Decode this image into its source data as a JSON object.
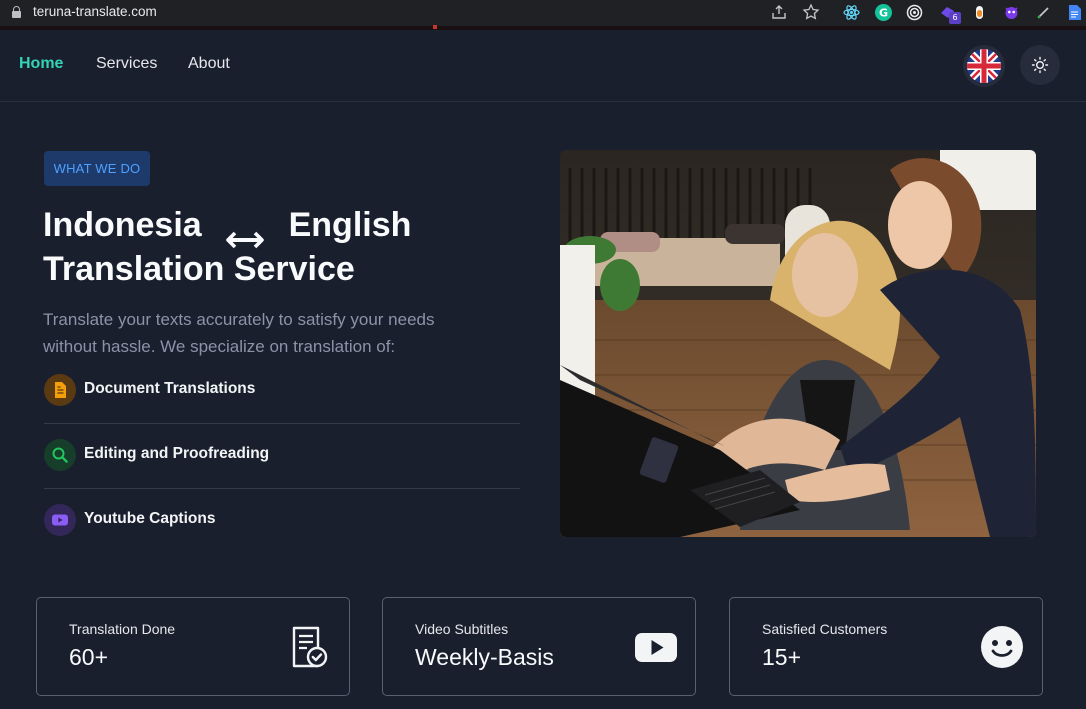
{
  "browser": {
    "url": "teruna-translate.com",
    "extension_badge": "6"
  },
  "nav": {
    "links": [
      {
        "label": "Home",
        "active": true
      },
      {
        "label": "Services",
        "active": false
      },
      {
        "label": "About",
        "active": false
      }
    ],
    "language_icon": "uk-flag-icon",
    "theme_icon": "sun-icon"
  },
  "hero": {
    "badge": "WHAT WE DO",
    "title_line1_left": "Indonesia",
    "title_line1_right": "English",
    "title_line2": "Translation Service",
    "description": "Translate your texts accurately to satisfy your needs without hassle. We specialize on translation of:",
    "services": [
      {
        "label": "Document Translations",
        "icon": "document-icon",
        "color": "#f59e0b"
      },
      {
        "label": "Editing and Proofreading",
        "icon": "search-icon",
        "color": "#22c55e"
      },
      {
        "label": "Youtube Captions",
        "icon": "youtube-icon",
        "color": "#8b5cf6"
      }
    ]
  },
  "stats": [
    {
      "title": "Translation Done",
      "value": "60+",
      "icon": "verified-document-icon"
    },
    {
      "title": "Video Subtitles",
      "value": "Weekly-Basis",
      "icon": "youtube-play-icon"
    },
    {
      "title": "Satisfied Customers",
      "value": "15+",
      "icon": "smiley-face-icon"
    }
  ],
  "colors": {
    "accent": "#34d3b6",
    "background": "#1a1f2e",
    "badge_bg": "#1d3a6b",
    "badge_text": "#4ea1ff"
  }
}
